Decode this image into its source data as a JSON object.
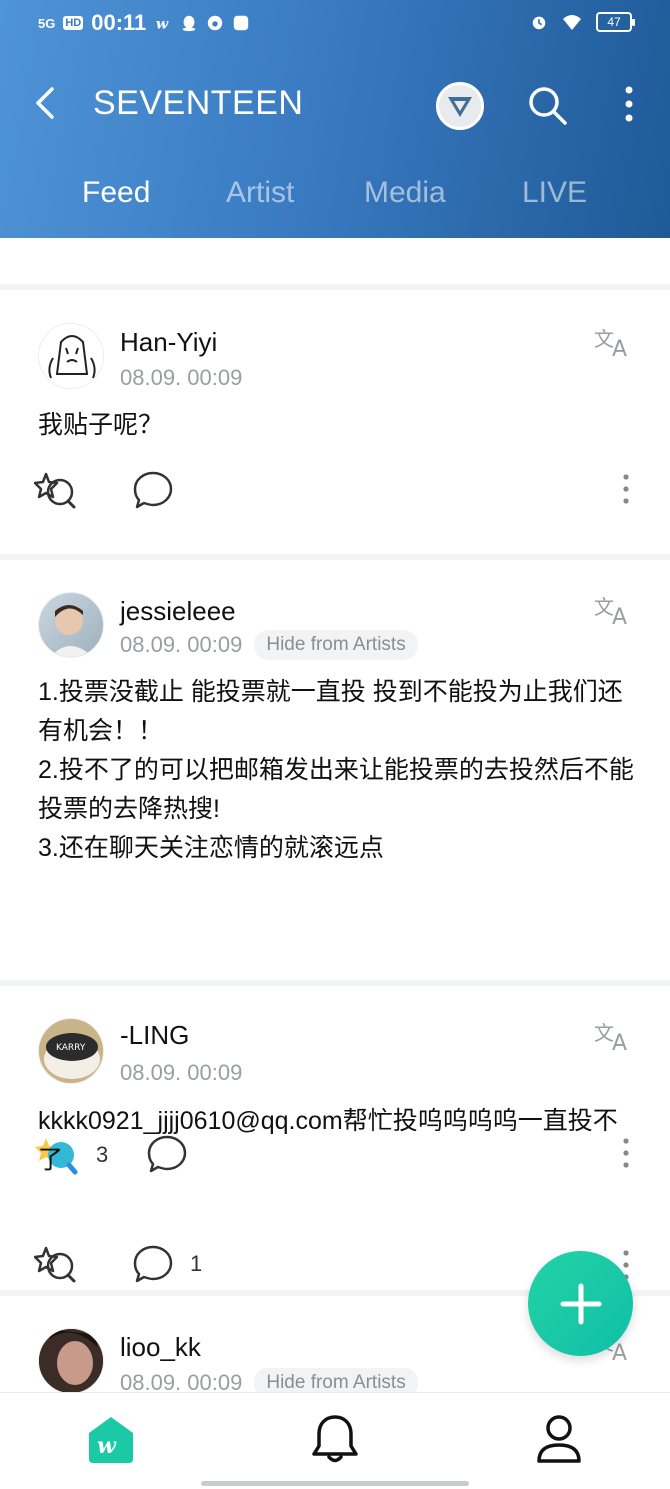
{
  "status_bar": {
    "network": "5G",
    "hd": "HD",
    "time": "00:11",
    "battery": "47"
  },
  "header": {
    "title": "SEVENTEEN",
    "icons": [
      "back-arrow-icon",
      "seventeen-logo-icon",
      "search-icon",
      "more-vertical-icon"
    ]
  },
  "tabs": [
    {
      "label": "Feed",
      "active": true
    },
    {
      "label": "Artist",
      "active": false
    },
    {
      "label": "Media",
      "active": false
    },
    {
      "label": "LIVE",
      "active": false
    }
  ],
  "posts": [
    {
      "username": "Han-Yiyi",
      "date": "08.09. 00:09",
      "badge": "",
      "text": "我贴子呢？",
      "likes": "",
      "comments": ""
    },
    {
      "username": "jessieleee",
      "date": "08.09. 00:09",
      "badge": "Hide from Artists",
      "text": "1.投票没截止 能投票就一直投 投到不能投为止我们还有机会！！\n2.投不了的可以把邮箱发出来让能投票的去投然后不能投票的去降热搜!\n3.还在聊天关注恋情的就滚远点",
      "likes": "3",
      "comments": ""
    },
    {
      "username": "-LING",
      "date": "08.09. 00:09",
      "badge": "",
      "text": "kkkk0921_jjjj0610@qq.com帮忙投呜呜呜呜一直投不了",
      "likes": "",
      "comments": "1"
    },
    {
      "username": "lioo_kk",
      "date": "08.09. 00:09",
      "badge": "Hide from Artists",
      "text": "",
      "likes": "",
      "comments": ""
    }
  ],
  "colors": {
    "header_start": "#4f94d6",
    "header_end": "#1f5a98",
    "accent": "#1cc9a6"
  },
  "bottom_nav": [
    "weverse-home-icon",
    "bell-icon",
    "profile-icon"
  ]
}
